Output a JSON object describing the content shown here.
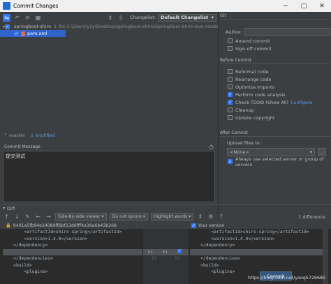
{
  "window": {
    "title": "Commit Changes",
    "minimize": "─",
    "maximize": "□",
    "close": "✕"
  },
  "toolbar": {
    "changelist_label": "Changelist:",
    "changelist_value": "Default Changelist",
    "git_tab": "Git"
  },
  "tree": {
    "root_name": "springboot-shiro",
    "root_info": "1 file  C:\\Users\\yzy\\Desktop\\springboot-shiro\\SpringBoot-Shiro-Vue-master",
    "file_name": "pom.xml"
  },
  "status": {
    "branch": "master",
    "modified": "1 modified"
  },
  "git": {
    "author_label": "Author:",
    "amend_commit": "Amend commit",
    "signoff_commit": "Sign-off commit",
    "before_commit_title": "Before Commit",
    "options": [
      {
        "label": "Reformat code",
        "checked": false
      },
      {
        "label": "Rearrange code",
        "checked": false
      },
      {
        "label": "Optimize imports",
        "checked": false
      },
      {
        "label": "Perform code analysis",
        "checked": true
      },
      {
        "label": "Check TODO (Show All)",
        "checked": true
      },
      {
        "label": "Cleanup",
        "checked": false
      },
      {
        "label": "Update copyright",
        "checked": false
      }
    ],
    "configure_link": "Configure",
    "after_commit_title": "After Commit",
    "upload_label": "Upload files to:",
    "upload_value": "<None>",
    "more_btn": "...",
    "always_use_servers": "Always use selected server or group of servers"
  },
  "commit_message": {
    "title": "Commit Message",
    "text": "提交测试"
  },
  "diff": {
    "title": "Diff",
    "viewer": "Side-by-side viewer",
    "ignore": "Do not ignore",
    "highlight": "Highlight words",
    "difference_count": "1 difference",
    "left_rev": "9401a5fb94e24089ff6bf13d6fff4e36a6b43b268",
    "right_rev": "Your version",
    "left_lines": [
      "        <artifactId>shiro-spring</artifactId>",
      "        <version>1.4.0</version>",
      "    </dependency>",
      "",
      "    </dependencies>",
      "    <build>",
      "        <plugins>"
    ],
    "right_lines": [
      "        <artifactId>shiro-spring</artifactId>",
      "        <version>1.4.0</version>",
      "    </dependency>",
      "",
      "    </dependencies>",
      "    <build>",
      "        <plugins>"
    ],
    "gutter_left": [
      "",
      "",
      "",
      "61",
      "62",
      "",
      ""
    ],
    "gutter_right": [
      "",
      "",
      "",
      "61",
      "62",
      "",
      ""
    ]
  },
  "commit_button": "Commit",
  "watermark": "https://blog.csdn.net/yang5726685"
}
